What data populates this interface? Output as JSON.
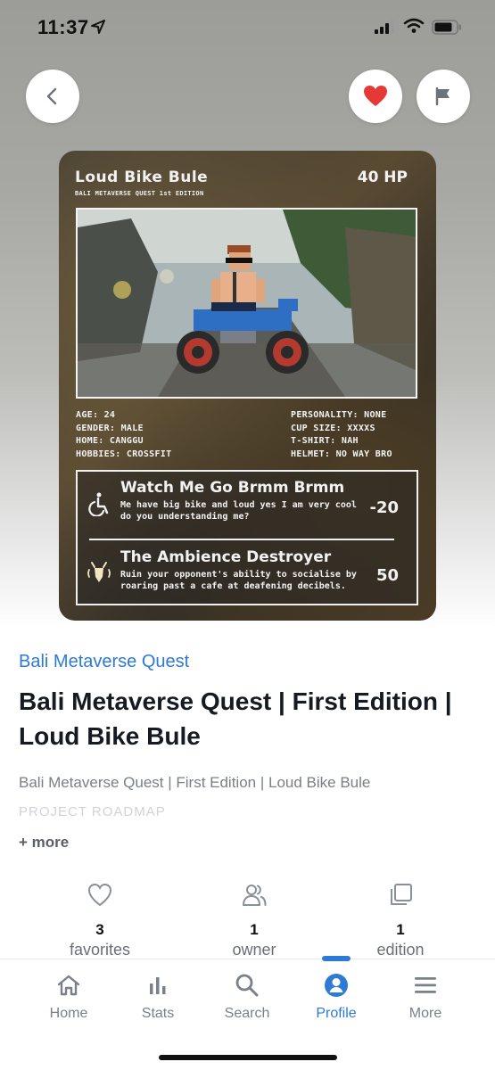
{
  "status": {
    "time": "11:37"
  },
  "card": {
    "name": "Loud Bike Bule",
    "subtitle": "BALI METAVERSE QUEST 1st EDITION",
    "hp": "40 HP",
    "stats_left": [
      "AGE: 24",
      "GENDER: MALE",
      "HOME: CANGGU",
      "HOBBIES: CROSSFIT"
    ],
    "stats_right": [
      "PERSONALITY: NONE",
      "CUP SIZE: XXXXS",
      "T-SHIRT: NAH",
      "HELMET: NO WAY BRO"
    ],
    "moves": [
      {
        "name": "Watch Me Go Brmm Brmm",
        "desc": "Me have big bike and loud yes I am very cool do you understanding me?",
        "damage": "-20",
        "icon": "wheelchair-icon"
      },
      {
        "name": "The Ambience Destroyer",
        "desc": "Ruin your opponent's ability to socialise by roaring past a cafe at deafening decibels.",
        "damage": "50",
        "icon": "loud-bull-icon"
      }
    ]
  },
  "details": {
    "collection": "Bali Metaverse Quest",
    "title": "Bali Metaverse Quest | First Edition | Loud Bike Bule",
    "description": "Bali Metaverse Quest | First Edition | Loud Bike Bule",
    "roadmap": "PROJECT ROADMAP",
    "more": "+ more"
  },
  "counters": [
    {
      "num": "3",
      "label": "favorites",
      "icon": "heart-outline-icon"
    },
    {
      "num": "1",
      "label": "owner",
      "icon": "people-icon"
    },
    {
      "num": "1",
      "label": "edition",
      "icon": "copies-icon"
    }
  ],
  "tabs": [
    {
      "label": "Home",
      "icon": "home-icon"
    },
    {
      "label": "Stats",
      "icon": "stats-icon"
    },
    {
      "label": "Search",
      "icon": "search-icon"
    },
    {
      "label": "Profile",
      "icon": "profile-icon",
      "active": true
    },
    {
      "label": "More",
      "icon": "menu-icon"
    }
  ],
  "colors": {
    "accent": "#2e7bd6",
    "heart": "#e53935",
    "text": "#161a23"
  }
}
